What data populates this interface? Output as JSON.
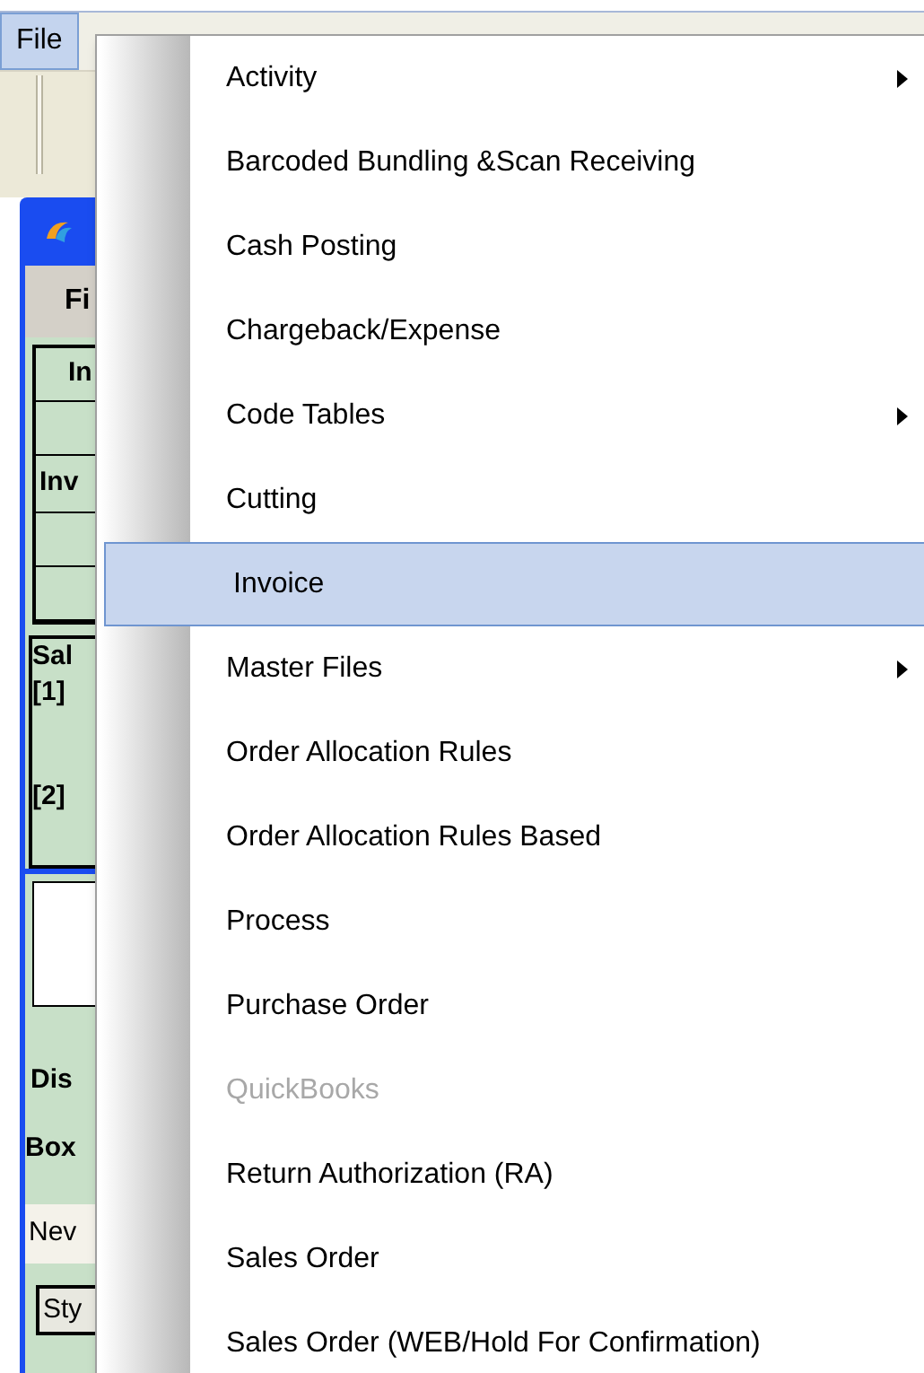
{
  "menubar": {
    "items": [
      {
        "label": "File",
        "selected": true
      }
    ]
  },
  "background_window": {
    "tab": "Fi",
    "labels": [
      "In",
      "Inv"
    ],
    "sales_labels": [
      "Sal",
      "[1]",
      "[2]"
    ],
    "lower_labels": [
      "Dis",
      "Box"
    ],
    "tab_strip": "Nev",
    "field": "Sty"
  },
  "menu": {
    "items": [
      {
        "label": "Activity",
        "submenu": true,
        "selected": false,
        "disabled": false
      },
      {
        "label": "Barcoded Bundling &Scan Receiving",
        "submenu": false,
        "selected": false,
        "disabled": false
      },
      {
        "label": "Cash Posting",
        "submenu": false,
        "selected": false,
        "disabled": false
      },
      {
        "label": "Chargeback/Expense",
        "submenu": false,
        "selected": false,
        "disabled": false
      },
      {
        "label": "Code Tables",
        "submenu": true,
        "selected": false,
        "disabled": false
      },
      {
        "label": "Cutting",
        "submenu": false,
        "selected": false,
        "disabled": false
      },
      {
        "label": "Invoice",
        "submenu": false,
        "selected": true,
        "disabled": false
      },
      {
        "label": "Master Files",
        "submenu": true,
        "selected": false,
        "disabled": false
      },
      {
        "label": "Order Allocation Rules",
        "submenu": false,
        "selected": false,
        "disabled": false
      },
      {
        "label": "Order Allocation Rules Based",
        "submenu": false,
        "selected": false,
        "disabled": false
      },
      {
        "label": "Process",
        "submenu": false,
        "selected": false,
        "disabled": false
      },
      {
        "label": "Purchase Order",
        "submenu": false,
        "selected": false,
        "disabled": false
      },
      {
        "label": "QuickBooks",
        "submenu": false,
        "selected": false,
        "disabled": true
      },
      {
        "label": "Return Authorization (RA)",
        "submenu": false,
        "selected": false,
        "disabled": false
      },
      {
        "label": "Sales Order",
        "submenu": false,
        "selected": false,
        "disabled": false
      },
      {
        "label": "Sales Order (WEB/Hold For Confirmation)",
        "submenu": false,
        "selected": false,
        "disabled": false
      }
    ]
  }
}
